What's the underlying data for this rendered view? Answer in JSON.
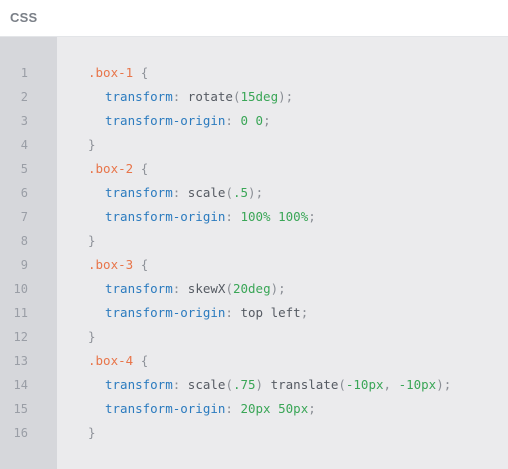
{
  "header": {
    "title": "CSS"
  },
  "gutter": {
    "line_numbers": [
      "1",
      "2",
      "3",
      "4",
      "5",
      "6",
      "7",
      "8",
      "9",
      "10",
      "11",
      "12",
      "13",
      "14",
      "15",
      "16"
    ]
  },
  "code": {
    "rule1": {
      "selector": ".box-1",
      "open": "{",
      "decl1": {
        "prop": "transform",
        "colon": ":",
        "fn": "rotate",
        "lp": "(",
        "arg": "15deg",
        "rp": ")",
        "semi": ";"
      },
      "decl2": {
        "prop": "transform-origin",
        "colon": ":",
        "v1": "0",
        "v2": "0",
        "semi": ";"
      },
      "close": "}"
    },
    "rule2": {
      "selector": ".box-2",
      "open": "{",
      "decl1": {
        "prop": "transform",
        "colon": ":",
        "fn": "scale",
        "lp": "(",
        "arg": ".5",
        "rp": ")",
        "semi": ";"
      },
      "decl2": {
        "prop": "transform-origin",
        "colon": ":",
        "v1": "100%",
        "v2": "100%",
        "semi": ";"
      },
      "close": "}"
    },
    "rule3": {
      "selector": ".box-3",
      "open": "{",
      "decl1": {
        "prop": "transform",
        "colon": ":",
        "fn": "skewX",
        "lp": "(",
        "arg": "20deg",
        "rp": ")",
        "semi": ";"
      },
      "decl2": {
        "prop": "transform-origin",
        "colon": ":",
        "v1": "top",
        "v2": "left",
        "semi": ";"
      },
      "close": "}"
    },
    "rule4": {
      "selector": ".box-4",
      "open": "{",
      "decl1": {
        "prop": "transform",
        "colon": ":",
        "fn1": "scale",
        "lp1": "(",
        "arg1": ".75",
        "rp1": ")",
        "fn2": "translate",
        "lp2": "(",
        "arg2a": "-10px",
        "comma": ",",
        "arg2b": "-10px",
        "rp2": ")",
        "semi": ";"
      },
      "decl2": {
        "prop": "transform-origin",
        "colon": ":",
        "v1": "20px",
        "v2": "50px",
        "semi": ";"
      },
      "close": "}"
    }
  },
  "colors": {
    "selector": "#e8754a",
    "property": "#2b7bbf",
    "number": "#3aa657",
    "value": "#555a62",
    "gutter_bg": "#d6d7db",
    "editor_bg": "#ebebed"
  }
}
